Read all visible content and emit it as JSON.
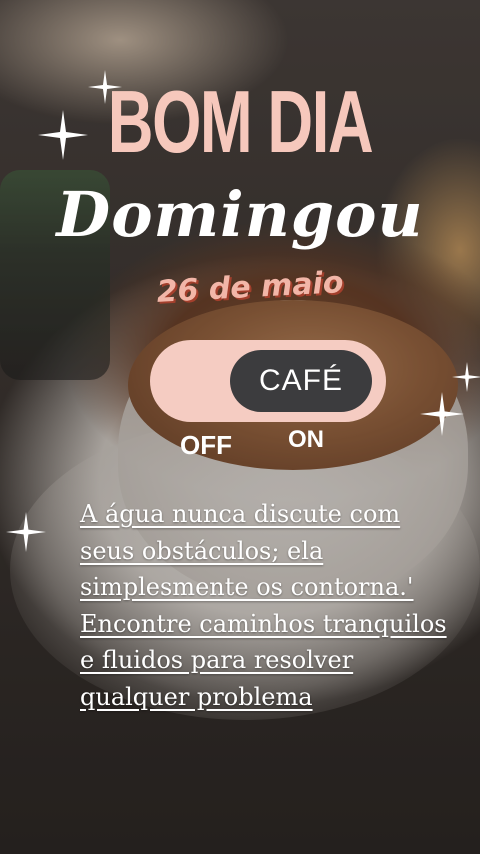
{
  "title": "BOM DIA",
  "day": "Domingou",
  "date": "26 de maio",
  "toggle": {
    "label": "CAFÉ",
    "off_label": "OFF",
    "on_label": "ON",
    "state": "on",
    "track_color": "#f5ccc2",
    "knob_color": "#3c3c3e"
  },
  "quote": "A água nunca discute com seus obstáculos; ela simplesmente os contorna.' Encontre caminhos tranquilos e fluidos para resolver qualquer problema",
  "colors": {
    "title": "#f6c8bc",
    "date": "#f2b6a8",
    "date_shadow": "#a33f2c",
    "text": "#ffffff"
  },
  "icons": [
    "sparkle-icon"
  ]
}
